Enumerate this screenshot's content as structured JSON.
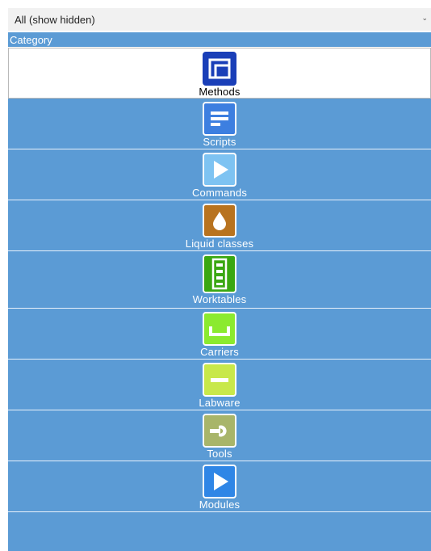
{
  "filter": {
    "value": "All (show hidden)"
  },
  "panel": {
    "header": "Category"
  },
  "categories": [
    {
      "label": "Methods",
      "icon": "methods-icon",
      "color": "#1a3fb8",
      "selected": true
    },
    {
      "label": "Scripts",
      "icon": "scripts-icon",
      "color": "#3d7fe0"
    },
    {
      "label": "Commands",
      "icon": "commands-icon",
      "color": "#7ec3f2"
    },
    {
      "label": "Liquid classes",
      "icon": "liquid-drop-icon",
      "color": "#b8731f"
    },
    {
      "label": "Worktables",
      "icon": "worktables-icon",
      "color": "#3aa712"
    },
    {
      "label": "Carriers",
      "icon": "carriers-icon",
      "color": "#8bea2f"
    },
    {
      "label": "Labware",
      "icon": "labware-icon",
      "color": "#c8e84a"
    },
    {
      "label": "Tools",
      "icon": "tools-wrench-icon",
      "color": "#a8b56a"
    },
    {
      "label": "Modules",
      "icon": "modules-icon",
      "color": "#2f86e6"
    }
  ]
}
